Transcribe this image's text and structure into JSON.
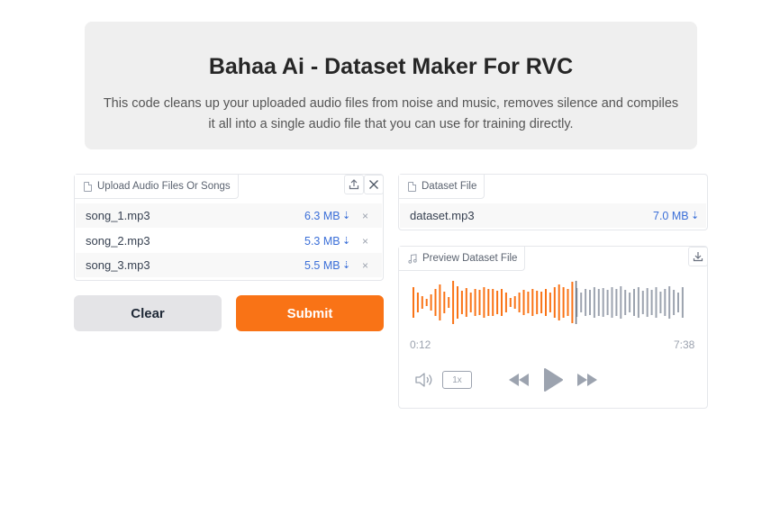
{
  "header": {
    "title": "Bahaa Ai - Dataset Maker For RVC",
    "description": "This code cleans up your uploaded audio files from noise and music, removes silence and compiles it all into a single audio file that you can use for training directly."
  },
  "upload": {
    "label": "Upload Audio Files Or Songs",
    "files": [
      {
        "name": "song_1.mp3",
        "size": "6.3 MB"
      },
      {
        "name": "song_2.mp3",
        "size": "5.3 MB"
      },
      {
        "name": "song_3.mp3",
        "size": "5.5 MB"
      }
    ],
    "remove_glyph": "×",
    "download_glyph": "⇣"
  },
  "buttons": {
    "clear": "Clear",
    "submit": "Submit"
  },
  "dataset": {
    "label": "Dataset File",
    "file_name": "dataset.mp3",
    "file_size": "7.0 MB"
  },
  "preview": {
    "label": "Preview Dataset File",
    "current_time": "0:12",
    "duration": "7:38",
    "playback_rate": "1x",
    "progress_fraction": 0.575
  },
  "colors": {
    "accent": "#f97316",
    "link": "#3b6fd8",
    "wave_unplayed": "#9ca3af"
  },
  "icons": {
    "upload": "upload-icon",
    "close": "close-icon",
    "file": "file-icon",
    "music": "music-icon",
    "download": "download-icon",
    "volume": "volume-icon",
    "rewind": "rewind-icon",
    "play": "play-icon",
    "fast_forward": "fast-forward-icon"
  }
}
